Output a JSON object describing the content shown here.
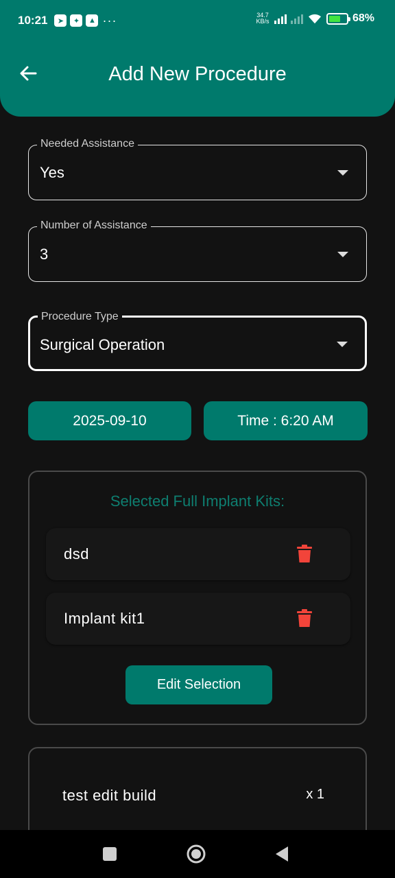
{
  "status_bar": {
    "time": "10:21",
    "more": "···",
    "net_speed_value": "34.7",
    "net_speed_unit": "KB/s",
    "battery_percent": "68%",
    "battery_level": 0.68,
    "battery_color": "#41E441"
  },
  "app_bar": {
    "title": "Add New Procedure",
    "back_icon": "arrow-left-icon",
    "color": "#007A6C"
  },
  "form": {
    "needed_assistance": {
      "label": "Needed Assistance",
      "value": "Yes"
    },
    "number_of_assistance": {
      "label": "Number of Assistance",
      "value": "3"
    },
    "procedure_type": {
      "label": "Procedure Type",
      "value": "Surgical Operation"
    },
    "date_button": "2025-09-10",
    "time_button": "Time : 6:20 AM"
  },
  "kits": {
    "title": "Selected Full Implant Kits:",
    "items": [
      {
        "label": "dsd",
        "icon": "trash-icon"
      },
      {
        "label": "Implant kit1",
        "icon": "trash-icon"
      }
    ],
    "edit_button": "Edit Selection",
    "title_color": "#0E7E70",
    "delete_color": "#F2443A"
  },
  "builds": {
    "items": [
      {
        "label": "test edit build",
        "quantity": "x 1"
      }
    ]
  },
  "nav_bar": {
    "buttons": [
      "recents-icon",
      "home-icon",
      "back-icon"
    ]
  }
}
